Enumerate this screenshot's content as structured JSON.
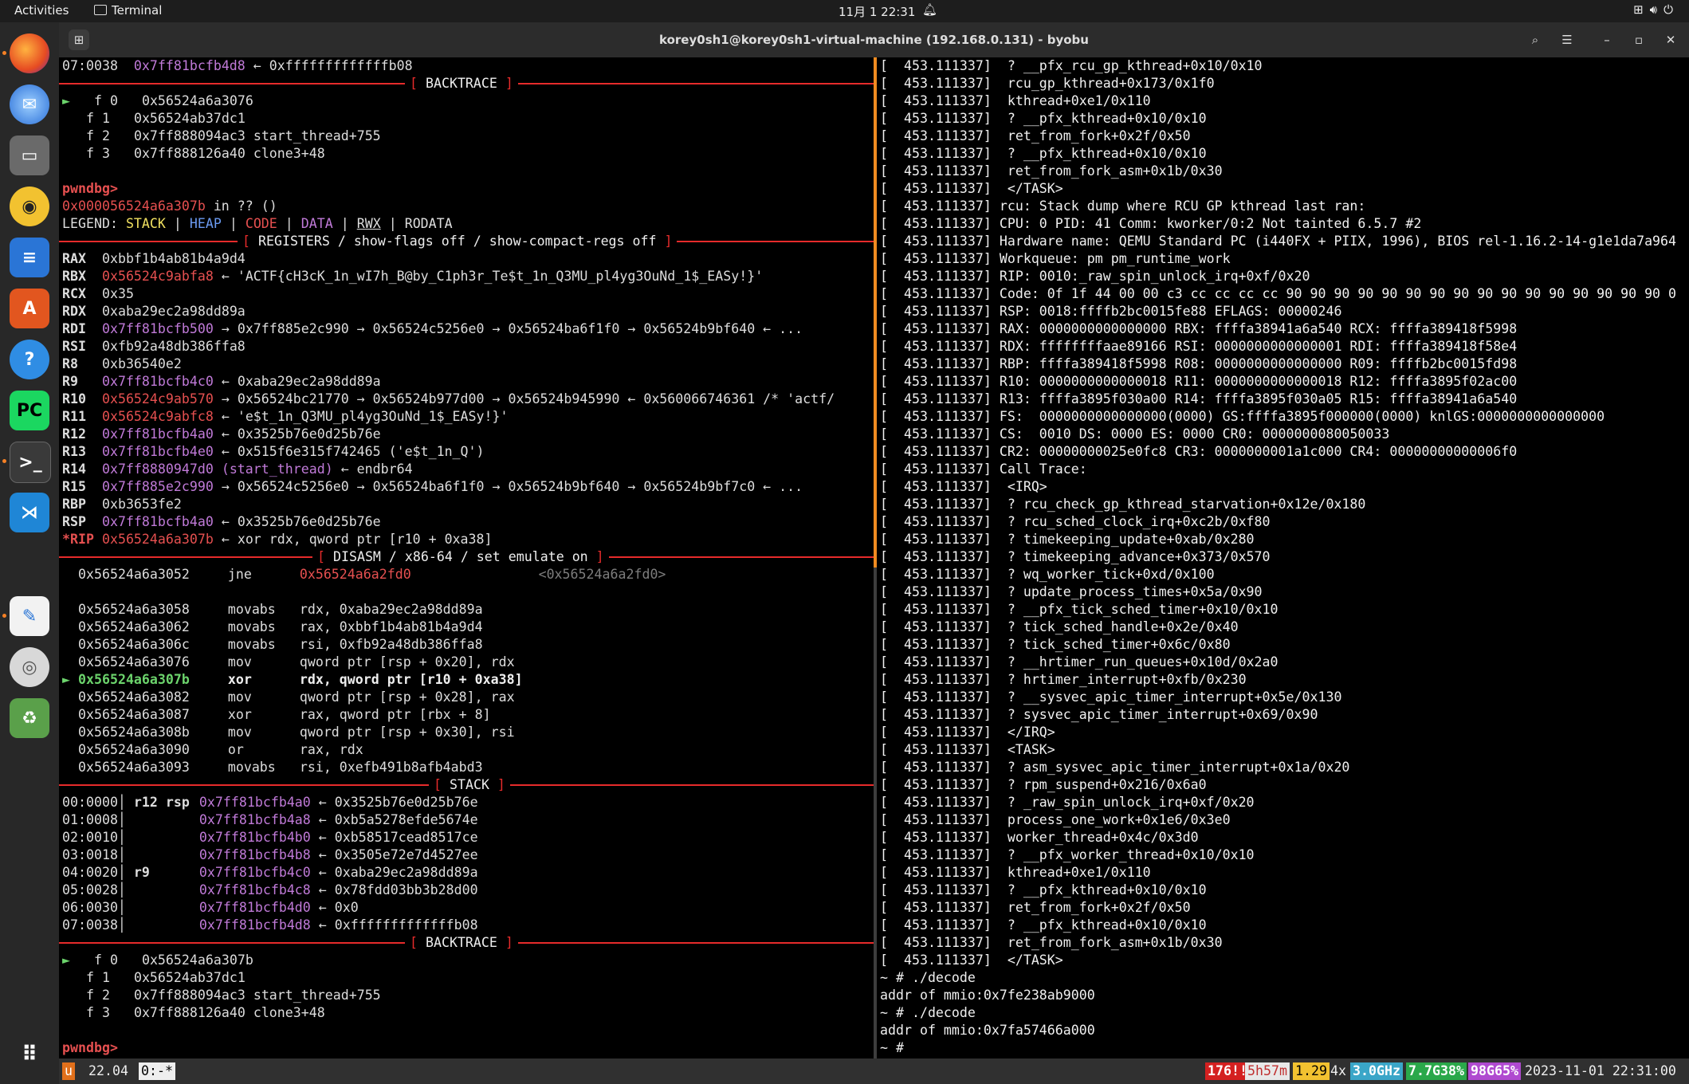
{
  "topbar": {
    "activities": "Activities",
    "app_name": "Terminal",
    "clock": "11月 1  22:31"
  },
  "window": {
    "title": "korey0sh1@korey0sh1-virtual-machine (192.168.0.131) - byobu"
  },
  "left": {
    "line1": "07:0038",
    "line1_addr": "0x7ff81bcfb4d8",
    "line1_val": "← 0xfffffffffffffb08",
    "hdr_backtrace": "BACKTRACE",
    "bt1": [
      {
        "mark": "►",
        "idx": "f 0",
        "addr": "0x56524a6a3076",
        "sym": ""
      },
      {
        "mark": "",
        "idx": "f 1",
        "addr": "0x56524ab37dc1",
        "sym": ""
      },
      {
        "mark": "",
        "idx": "f 2",
        "addr": "0x7ff888094ac3",
        "sym": "start_thread+755"
      },
      {
        "mark": "",
        "idx": "f 3",
        "addr": "0x7ff888126a40",
        "sym": "clone3+48"
      }
    ],
    "prompt": "pwndbg>",
    "where": "0x000056524a6a307b",
    "where_rest": " in ?? ()",
    "legend": {
      "label": "LEGEND:",
      "stack": "STACK",
      "heap": "HEAP",
      "code": "CODE",
      "data": "DATA",
      "rwx": "RWX",
      "rodata": "RODATA"
    },
    "hdr_registers": "REGISTERS / show-flags off / show-compact-regs off",
    "regs": [
      {
        "name": "RAX",
        "a": "0xbbf1b4ab81b4a9d4",
        "rest": ""
      },
      {
        "name": "RBX",
        "a": "0x56524c9abfa8",
        "rest": "← 'ACTF{cH3cK_1n_wI7h_B@by_C1ph3r_Te$t_1n_Q3MU_pl4yg3OuNd_1$_EASy!}'"
      },
      {
        "name": "RCX",
        "a": "0x35",
        "rest": ""
      },
      {
        "name": "RDX",
        "a": "0xaba29ec2a98dd89a",
        "rest": ""
      },
      {
        "name": "RDI",
        "a": "0x7ff81bcfb500",
        "rest": "→ 0x7ff885e2c990 → 0x56524c5256e0 → 0x56524ba6f1f0 → 0x56524b9bf640 ← ..."
      },
      {
        "name": "RSI",
        "a": "0xfb92a48db386ffa8",
        "rest": ""
      },
      {
        "name": "R8",
        "a": "0xb36540e2",
        "rest": ""
      },
      {
        "name": "R9",
        "a": "0x7ff81bcfb4c0",
        "rest": "← 0xaba29ec2a98dd89a"
      },
      {
        "name": "R10",
        "a": "0x56524c9ab570",
        "rest": "→ 0x56524bc21770 → 0x56524b977d00 → 0x56524b945990 ← 0x560066746361 /* 'actf/"
      },
      {
        "name": "R11",
        "a": "0x56524c9abfc8",
        "rest": "← 'e$t_1n_Q3MU_pl4yg3OuNd_1$_EASy!}'"
      },
      {
        "name": "R12",
        "a": "0x7ff81bcfb4a0",
        "rest": "← 0x3525b76e0d25b76e"
      },
      {
        "name": "R13",
        "a": "0x7ff81bcfb4e0",
        "rest": "← 0x515f6e315f742465 ('e$t_1n_Q')"
      },
      {
        "name": "R14",
        "a": "0x7ff8880947d0 (start_thread)",
        "rest": "← endbr64"
      },
      {
        "name": "R15",
        "a": "0x7ff885e2c990",
        "rest": "→ 0x56524c5256e0 → 0x56524ba6f1f0 → 0x56524b9bf640 → 0x56524b9bf7c0 ← ..."
      },
      {
        "name": "RBP",
        "a": "0xb3653fe2",
        "rest": ""
      },
      {
        "name": "RSP",
        "a": "0x7ff81bcfb4a0",
        "rest": "← 0x3525b76e0d25b76e"
      },
      {
        "name": "*RIP",
        "a": "0x56524a6a307b",
        "rest": "← xor rdx, qword ptr [r10 + 0xa38]"
      }
    ],
    "hdr_disasm": "DISASM / x86-64 / set emulate on",
    "disasm": [
      {
        "cur": "",
        "addr": "0x56524a6a3052",
        "op": "jne",
        "args": "0x56524a6a2fd0",
        "extra": "<0x56524a6a2fd0>"
      },
      {
        "cur": "",
        "addr": "",
        "op": "",
        "args": "",
        "extra": ""
      },
      {
        "cur": "",
        "addr": "0x56524a6a3058",
        "op": "movabs",
        "args": "rdx, 0xaba29ec2a98dd89a",
        "extra": ""
      },
      {
        "cur": "",
        "addr": "0x56524a6a3062",
        "op": "movabs",
        "args": "rax, 0xbbf1b4ab81b4a9d4",
        "extra": ""
      },
      {
        "cur": "",
        "addr": "0x56524a6a306c",
        "op": "movabs",
        "args": "rsi, 0xfb92a48db386ffa8",
        "extra": ""
      },
      {
        "cur": "",
        "addr": "0x56524a6a3076",
        "op": "mov",
        "args": "qword ptr [rsp + 0x20], rdx",
        "extra": ""
      },
      {
        "cur": "►",
        "addr": "0x56524a6a307b",
        "op": "xor",
        "args": "rdx, qword ptr [r10 + 0xa38]",
        "extra": ""
      },
      {
        "cur": "",
        "addr": "0x56524a6a3082",
        "op": "mov",
        "args": "qword ptr [rsp + 0x28], rax",
        "extra": ""
      },
      {
        "cur": "",
        "addr": "0x56524a6a3087",
        "op": "xor",
        "args": "rax, qword ptr [rbx + 8]",
        "extra": ""
      },
      {
        "cur": "",
        "addr": "0x56524a6a308b",
        "op": "mov",
        "args": "qword ptr [rsp + 0x30], rsi",
        "extra": ""
      },
      {
        "cur": "",
        "addr": "0x56524a6a3090",
        "op": "or",
        "args": "rax, rdx",
        "extra": ""
      },
      {
        "cur": "",
        "addr": "0x56524a6a3093",
        "op": "movabs",
        "args": "rsi, 0xefb491b8afb4abd3",
        "extra": ""
      }
    ],
    "hdr_stack": "STACK",
    "stack": [
      {
        "off": "00:0000",
        "reg": "r12 rsp",
        "addr": "0x7ff81bcfb4a0",
        "val": "← 0x3525b76e0d25b76e"
      },
      {
        "off": "01:0008",
        "reg": "",
        "addr": "0x7ff81bcfb4a8",
        "val": "← 0xb5a5278efde5674e"
      },
      {
        "off": "02:0010",
        "reg": "",
        "addr": "0x7ff81bcfb4b0",
        "val": "← 0xb58517cead8517ce"
      },
      {
        "off": "03:0018",
        "reg": "",
        "addr": "0x7ff81bcfb4b8",
        "val": "← 0x3505e72e7d4527ee"
      },
      {
        "off": "04:0020",
        "reg": "r9",
        "addr": "0x7ff81bcfb4c0",
        "val": "← 0xaba29ec2a98dd89a"
      },
      {
        "off": "05:0028",
        "reg": "",
        "addr": "0x7ff81bcfb4c8",
        "val": "← 0x78fdd03bb3b28d00"
      },
      {
        "off": "06:0030",
        "reg": "",
        "addr": "0x7ff81bcfb4d0",
        "val": "← 0x0"
      },
      {
        "off": "07:0038",
        "reg": "",
        "addr": "0x7ff81bcfb4d8",
        "val": "← 0xfffffffffffffb08"
      }
    ],
    "bt2": [
      {
        "mark": "►",
        "idx": "f 0",
        "addr": "0x56524a6a307b",
        "sym": ""
      },
      {
        "mark": "",
        "idx": "f 1",
        "addr": "0x56524ab37dc1",
        "sym": ""
      },
      {
        "mark": "",
        "idx": "f 2",
        "addr": "0x7ff888094ac3",
        "sym": "start_thread+755"
      },
      {
        "mark": "",
        "idx": "f 3",
        "addr": "0x7ff888126a40",
        "sym": "clone3+48"
      }
    ],
    "prompt2": "pwndbg>"
  },
  "right": {
    "lines": [
      "[  453.111337]  ? __pfx_rcu_gp_kthread+0x10/0x10",
      "[  453.111337]  rcu_gp_kthread+0x173/0x1f0",
      "[  453.111337]  kthread+0xe1/0x110",
      "[  453.111337]  ? __pfx_kthread+0x10/0x10",
      "[  453.111337]  ret_from_fork+0x2f/0x50",
      "[  453.111337]  ? __pfx_kthread+0x10/0x10",
      "[  453.111337]  ret_from_fork_asm+0x1b/0x30",
      "[  453.111337]  </TASK>",
      "[  453.111337] rcu: Stack dump where RCU GP kthread last ran:",
      "[  453.111337] CPU: 0 PID: 41 Comm: kworker/0:2 Not tainted 6.5.7 #2",
      "[  453.111337] Hardware name: QEMU Standard PC (i440FX + PIIX, 1996), BIOS rel-1.16.2-14-g1e1da7a964",
      "[  453.111337] Workqueue: pm pm_runtime_work",
      "[  453.111337] RIP: 0010:_raw_spin_unlock_irq+0xf/0x20",
      "[  453.111337] Code: 0f 1f 44 00 00 c3 cc cc cc cc 90 90 90 90 90 90 90 90 90 90 90 90 90 90 90 90 0",
      "[  453.111337] RSP: 0018:ffffb2bc0015fe88 EFLAGS: 00000246",
      "[  453.111337] RAX: 0000000000000000 RBX: ffffa38941a6a540 RCX: ffffa389418f5998",
      "[  453.111337] RDX: ffffffffaae89166 RSI: 0000000000000001 RDI: ffffa389418f58e4",
      "[  453.111337] RBP: ffffa389418f5998 R08: 0000000000000000 R09: ffffb2bc0015fd98",
      "[  453.111337] R10: 0000000000000018 R11: 0000000000000018 R12: ffffa3895f02ac00",
      "[  453.111337] R13: ffffa3895f030a00 R14: ffffa3895f030a05 R15: ffffa38941a6a540",
      "[  453.111337] FS:  0000000000000000(0000) GS:ffffa3895f000000(0000) knlGS:0000000000000000",
      "[  453.111337] CS:  0010 DS: 0000 ES: 0000 CR0: 0000000080050033",
      "[  453.111337] CR2: 00000000025e0fc8 CR3: 0000000001a1c000 CR4: 00000000000006f0",
      "[  453.111337] Call Trace:",
      "[  453.111337]  <IRQ>",
      "[  453.111337]  ? rcu_check_gp_kthread_starvation+0x12e/0x180",
      "[  453.111337]  ? rcu_sched_clock_irq+0xc2b/0xf80",
      "[  453.111337]  ? timekeeping_update+0xab/0x280",
      "[  453.111337]  ? timekeeping_advance+0x373/0x570",
      "[  453.111337]  ? wq_worker_tick+0xd/0x100",
      "[  453.111337]  ? update_process_times+0x5a/0x90",
      "[  453.111337]  ? __pfx_tick_sched_timer+0x10/0x10",
      "[  453.111337]  ? tick_sched_handle+0x2e/0x40",
      "[  453.111337]  ? tick_sched_timer+0x6c/0x80",
      "[  453.111337]  ? __hrtimer_run_queues+0x10d/0x2a0",
      "[  453.111337]  ? hrtimer_interrupt+0xfb/0x230",
      "[  453.111337]  ? __sysvec_apic_timer_interrupt+0x5e/0x130",
      "[  453.111337]  ? sysvec_apic_timer_interrupt+0x69/0x90",
      "[  453.111337]  </IRQ>",
      "[  453.111337]  <TASK>",
      "[  453.111337]  ? asm_sysvec_apic_timer_interrupt+0x1a/0x20",
      "[  453.111337]  ? rpm_suspend+0x216/0x6a0",
      "[  453.111337]  ? _raw_spin_unlock_irq+0xf/0x20",
      "[  453.111337]  process_one_work+0x1e6/0x3e0",
      "[  453.111337]  worker_thread+0x4c/0x3d0",
      "[  453.111337]  ? __pfx_worker_thread+0x10/0x10",
      "[  453.111337]  kthread+0xe1/0x110",
      "[  453.111337]  ? __pfx_kthread+0x10/0x10",
      "[  453.111337]  ret_from_fork+0x2f/0x50",
      "[  453.111337]  ? __pfx_kthread+0x10/0x10",
      "[  453.111337]  ret_from_fork_asm+0x1b/0x30",
      "[  453.111337]  </TASK>",
      "~ # ./decode",
      "addr of mmio:0x7fe238ab9000",
      "~ # ./decode",
      "addr of mmio:0x7fa57466a000",
      "~ # "
    ]
  },
  "status": {
    "session": "u",
    "release": "22.04",
    "window": "0:-*",
    "updates": "176!!",
    "uptime": "5h57m",
    "load": "1.29",
    "cpu_count": "4x",
    "cpu_freq": "3.0GHz",
    "mem": "7.7G38%",
    "disk": "98G65%",
    "datetime": "2023-11-01 22:31:00"
  },
  "colors": {
    "accent_orange": "#f08b20",
    "rule_red": "#e62b2b",
    "yellow": "#f0e060",
    "magenta": "#c07ad8",
    "red": "#e65050"
  }
}
